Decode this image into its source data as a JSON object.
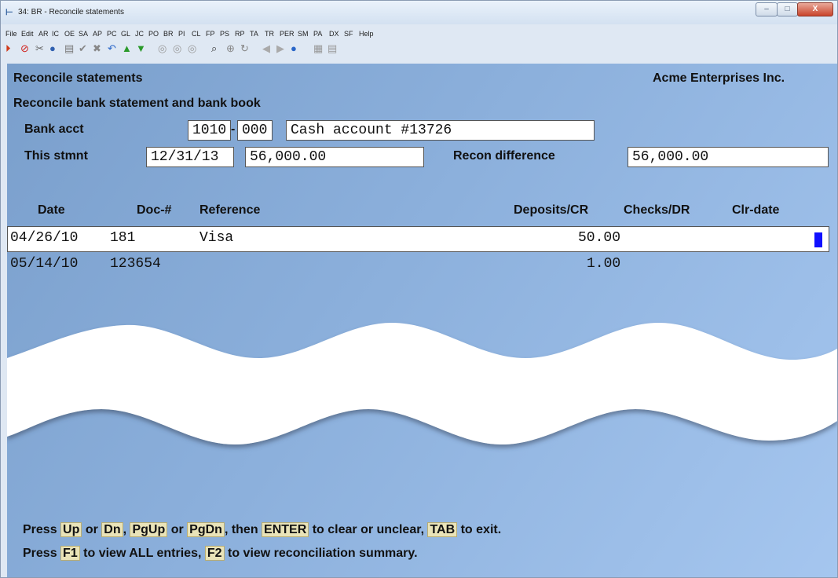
{
  "window": {
    "title": "34: BR - Reconcile statements",
    "controls": {
      "minimize": "–",
      "maximize": "□",
      "close": "X"
    }
  },
  "menu": [
    "File",
    "Edit",
    "AR",
    "IC",
    "OE",
    "SA",
    "AP",
    "PC",
    "GL",
    "JC",
    "PO",
    "BR",
    "PI",
    "CL",
    "FP",
    "PS",
    "RP",
    "TA",
    "TR",
    "PER",
    "SM",
    "PA",
    "DX",
    "SF",
    "Help"
  ],
  "toolbar_icons": [
    "go-icon",
    "stop-icon",
    "tools-icon",
    "globe-icon",
    "print-icon",
    "check-icon",
    "delete-icon",
    "undo-icon",
    "up-arrow-icon",
    "down-arrow-icon",
    "record-first-icon",
    "record-middle-icon",
    "record-last-icon",
    "find-icon",
    "zoom-icon",
    "refresh-icon",
    "prev-icon",
    "next-icon",
    "help-icon",
    "calculator-icon",
    "notes-icon"
  ],
  "screen": {
    "title": "Reconcile statements",
    "company": "Acme Enterprises Inc.",
    "subtitle": "Reconcile bank statement and bank book",
    "bank_acct_label": "Bank acct",
    "bank_acct_main": "1010",
    "bank_acct_sep": "-",
    "bank_acct_sub": "000",
    "bank_acct_desc": "Cash account #13726",
    "stmnt_label": "This stmnt",
    "stmnt_date": "12/31/13",
    "stmnt_amount": "56,000.00",
    "recon_diff_label": "Recon difference",
    "recon_diff_value": "56,000.00"
  },
  "table": {
    "headers": {
      "date": "Date",
      "doc": "Doc-#",
      "reference": "Reference",
      "deposits": "Deposits/CR",
      "checks": "Checks/DR",
      "clr_date": "Clr-date"
    },
    "rows": [
      {
        "date": "04/26/10",
        "doc": "181",
        "reference": "Visa",
        "deposits": "50.00",
        "checks": "",
        "clr_date": ""
      },
      {
        "date": "05/14/10",
        "doc": "123654",
        "reference": "",
        "deposits": "1.00",
        "checks": "",
        "clr_date": ""
      }
    ]
  },
  "help": {
    "line1": {
      "t1": "Press ",
      "k1": "Up",
      "t2": " or ",
      "k2": "Dn",
      "t3": ", ",
      "k3": "PgUp",
      "t4": " or ",
      "k4": "PgDn",
      "t5": ", then ",
      "k5": "ENTER",
      "t6": " to clear or unclear, ",
      "k6": "TAB",
      "t7": " to exit."
    },
    "line2": {
      "t1": "Press ",
      "k1": "F1",
      "t2": " to view ALL entries, ",
      "k2": "F2",
      "t3": " to view reconciliation summary."
    }
  }
}
